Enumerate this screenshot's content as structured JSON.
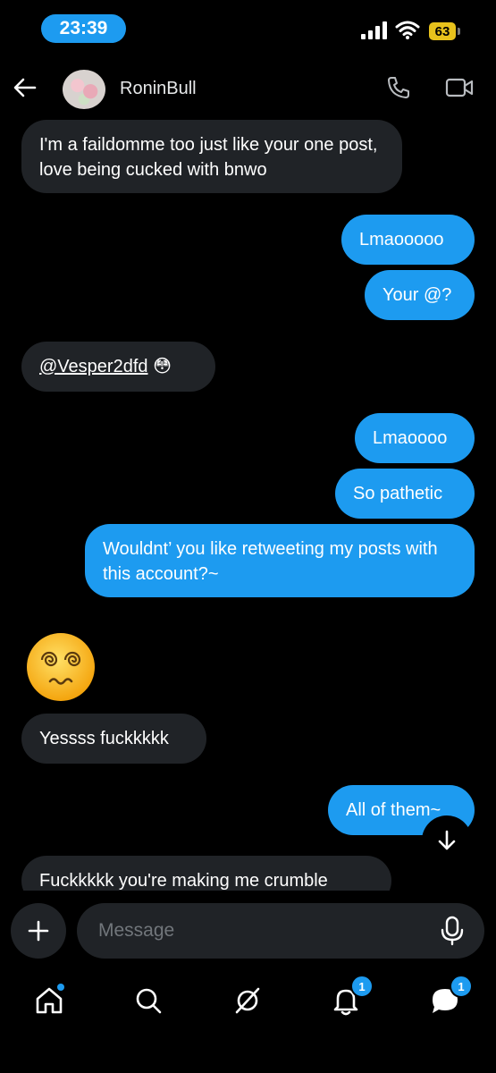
{
  "status_bar": {
    "time": "23:39",
    "battery": "63",
    "icons": [
      "signal-icon",
      "wifi-icon",
      "battery-icon"
    ]
  },
  "header": {
    "username": "RoninBull",
    "icons": [
      "back-arrow-icon",
      "avatar",
      "phone-call-icon",
      "video-call-icon"
    ]
  },
  "messages": [
    {
      "direction": "in",
      "text": "I'm a faildomme too just like your one post, love being cucked with bnwo"
    },
    {
      "direction": "out",
      "text": "Lmaooooo"
    },
    {
      "direction": "out",
      "text": "Your @?"
    },
    {
      "direction": "in",
      "mention": "@Vesper2dfd",
      "emoji": "😳"
    },
    {
      "direction": "out",
      "text": "Lmaoooo"
    },
    {
      "direction": "out",
      "text": "So pathetic"
    },
    {
      "direction": "out",
      "text": "Wouldnt’ you like retweeting my posts with this account?~"
    },
    {
      "direction": "in",
      "emoji": "😵‍💫"
    },
    {
      "direction": "in",
      "text": "Yessss fuckkkkk"
    },
    {
      "direction": "out",
      "text": "All of them~"
    },
    {
      "direction": "in",
      "text": "Fuckkkkk you're making me crumble"
    }
  ],
  "composer": {
    "placeholder": "Message",
    "add_icon": "plus-icon",
    "mic_icon": "microphone-icon"
  },
  "bottom_nav": {
    "items": [
      {
        "name": "home-icon",
        "indicator": "dot"
      },
      {
        "name": "search-icon"
      },
      {
        "name": "grok-icon"
      },
      {
        "name": "notifications-icon",
        "badge": "1"
      },
      {
        "name": "messages-icon",
        "badge": "1"
      }
    ]
  },
  "colors": {
    "background": "#000000",
    "accent": "#1d9bf0",
    "incoming_bubble": "#202327",
    "placeholder": "#71767b",
    "battery": "#e8c21c"
  }
}
